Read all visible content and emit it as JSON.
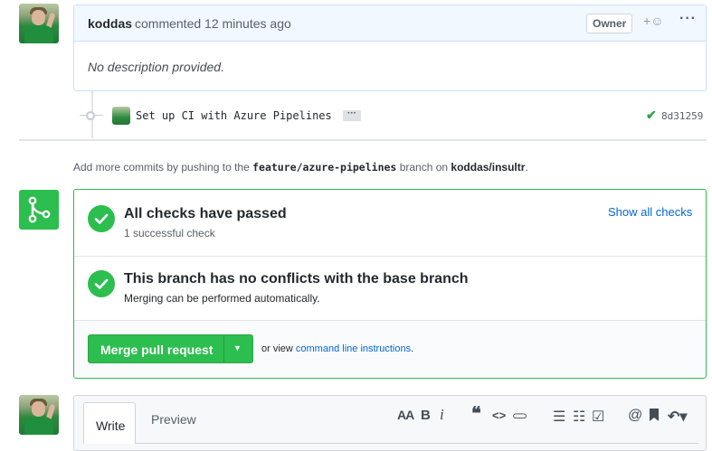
{
  "comment": {
    "author": "koddas",
    "action": "commented 12 minutes ago",
    "badge": "Owner",
    "reaction_icon": "+☺",
    "more_icon": "···",
    "body": "No description provided."
  },
  "commit": {
    "message": "Set up CI with Azure Pipelines",
    "ellipsis": "···",
    "status_icon": "✔",
    "sha": "8d31259"
  },
  "hint": {
    "prefix": "Add more commits by pushing to the",
    "branch": "feature/azure-pipelines",
    "middle": "branch on",
    "repo": "koddas/insultr",
    "suffix": "."
  },
  "merge": {
    "checks_title": "All checks have passed",
    "checks_sub": "1 successful check",
    "show_checks": "Show all checks",
    "conflicts_title": "This branch has no conflicts with the base branch",
    "conflicts_sub": "Merging can be performed automatically.",
    "button_label": "Merge pull request",
    "or_view": "or view",
    "cli_link": "command line instructions",
    "cli_suffix": "."
  },
  "editor": {
    "tab_write": "Write",
    "tab_preview": "Preview",
    "tools": {
      "heading": "AA",
      "bold": "B",
      "italic": "i",
      "quote": "❝",
      "code": "<>",
      "link": "⊂⊃",
      "bullet_list": "☰",
      "numbered_list": "☷",
      "task_list": "☑",
      "mention": "@",
      "bookmark": "🔖",
      "reply": "↶▾"
    }
  },
  "colors": {
    "success": "#2cbe4e",
    "link": "#0366d6",
    "header_bg": "#f1f8ff"
  }
}
